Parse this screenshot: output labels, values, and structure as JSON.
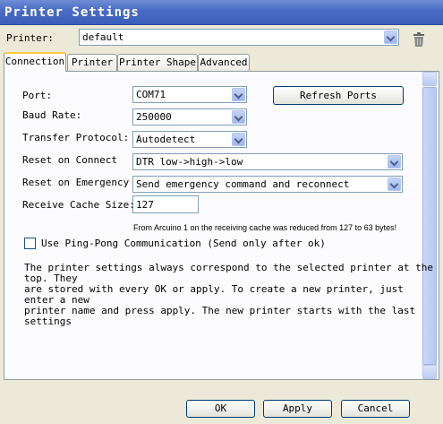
{
  "window": {
    "title": "Printer Settings"
  },
  "printer": {
    "label": "Printer:",
    "value": "default"
  },
  "tabs": [
    {
      "label": "Connection"
    },
    {
      "label": "Printer"
    },
    {
      "label": "Printer Shape"
    },
    {
      "label": "Advanced"
    }
  ],
  "connection": {
    "port": {
      "label": "Port:",
      "value": "COM71"
    },
    "refresh_label": "Refresh Ports",
    "baud": {
      "label": "Baud Rate:",
      "value": "250000"
    },
    "protocol": {
      "label": "Transfer Protocol:",
      "value": "Autodetect"
    },
    "reset_connect": {
      "label": "Reset on Connect",
      "value": "DTR low->high->low"
    },
    "reset_emergency": {
      "label": "Reset on Emergency",
      "value": "Send emergency command and reconnect"
    },
    "cache": {
      "label": "Receive Cache Size:",
      "value": "127"
    },
    "cache_note": "From Arcuino 1 on the receiving cache was reduced from 127 to 63 bytes!",
    "pingpong_label": "Use Ping-Pong Communication (Send only after ok)",
    "info": "The printer settings always correspond to the selected printer at the\ntop. They\nare stored with every OK or apply. To create a new printer, just\nenter a new\nprinter name and press apply. The new printer starts with the last\nsettings"
  },
  "buttons": {
    "ok": "OK",
    "apply": "Apply",
    "cancel": "Cancel"
  }
}
